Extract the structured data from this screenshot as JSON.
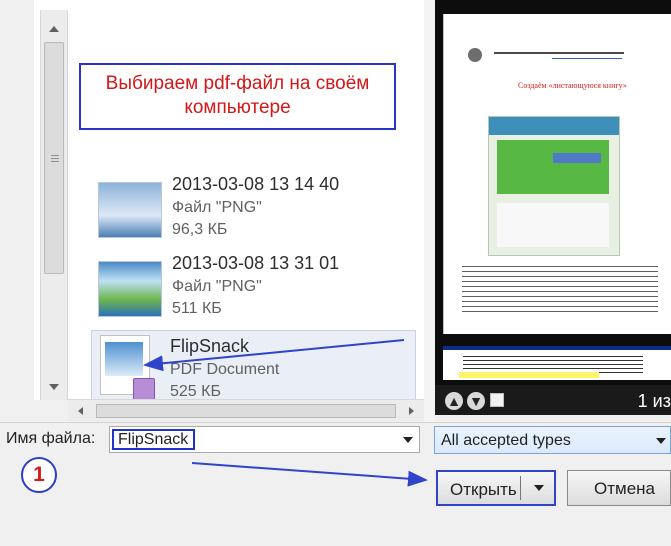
{
  "dialog": {
    "callout_text": "Выбираем pdf-файл на своём компьютере",
    "files": [
      {
        "name": "2013-03-08 13 14 40",
        "type": "Файл \"PNG\"",
        "size": "96,3 КБ"
      },
      {
        "name": "2013-03-08 13 31 01",
        "type": "Файл \"PNG\"",
        "size": "511 КБ"
      },
      {
        "name": "FlipSnack",
        "type": "PDF Document",
        "size": "525 КБ"
      }
    ],
    "preview": {
      "page_title": "Создаём «листающуюся книгу»",
      "page_count": "1 из"
    },
    "filename_label": "Имя файла:",
    "filename_value": "FlipSnack",
    "file_type": "All accepted types",
    "open_label": "Открыть",
    "cancel_label": "Отмена",
    "step_number": "1"
  },
  "colors": {
    "accent": "#2f43cb",
    "callout_text": "#d41717",
    "marker_text": "#d31d1d"
  }
}
